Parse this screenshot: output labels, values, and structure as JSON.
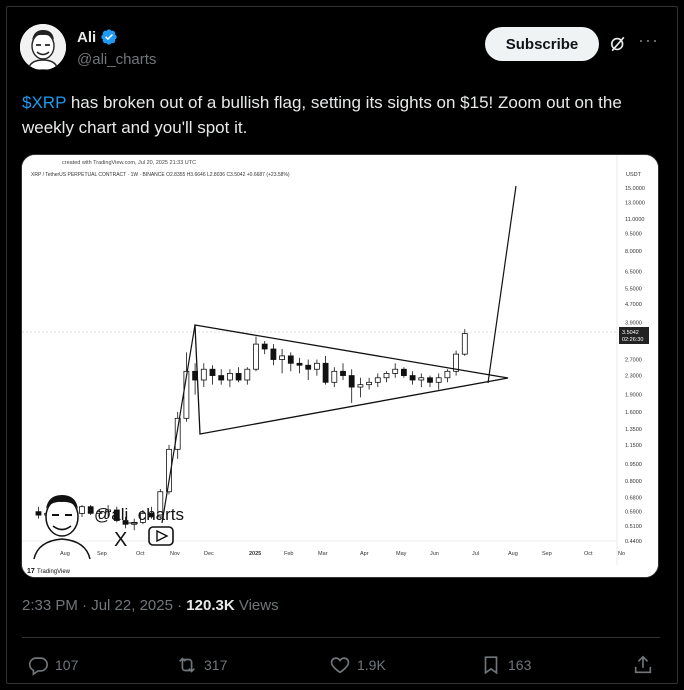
{
  "author": {
    "name": "Ali",
    "handle": "@ali_charts"
  },
  "header": {
    "subscribe_label": "Subscribe"
  },
  "tweet": {
    "cashtag": "$XRP",
    "text": " has broken out of a bullish flag, setting its sights on $15! Zoom out on the weekly chart and you'll spot it."
  },
  "chart": {
    "created": "created with TradingView.com, Jul 20, 2025 21:33 UTC",
    "symbol_line": "XRP / TetherUS PERPETUAL CONTRACT · 1W · BINANCE  O2.8355  H3.6646  L2.8036  C3.5042  +0.6687 (+23.58%)",
    "currency": "USDT",
    "watermark": "@ali_charts",
    "x_logo": "X",
    "brand": "TradingView",
    "price_tag": "3.5042",
    "price_time": "02:26:30",
    "chart_data": {
      "type": "candlestick",
      "title": "XRP / TetherUS PERPETUAL CONTRACT · 1W · BINANCE",
      "y_axis_scale": "log",
      "y_ticks": [
        "15.0000",
        "13.0000",
        "11.0000",
        "9.5000",
        "8.0000",
        "6.5000",
        "5.5000",
        "4.7000",
        "3.9000",
        "2.7000",
        "2.3000",
        "1.9000",
        "1.6000",
        "1.3500",
        "1.1500",
        "0.9500",
        "0.8000",
        "0.6800",
        "0.5900",
        "0.5100",
        "0.4400"
      ],
      "x_ticks": [
        "Aug",
        "Sep",
        "Oct",
        "Nov",
        "Dec",
        "2025",
        "Feb",
        "Mar",
        "Apr",
        "May",
        "Jun",
        "Jul",
        "Aug",
        "Sep",
        "Oct",
        "No"
      ],
      "last_price": 3.5042,
      "target": 15.0,
      "pattern": "bullish flag (triangle)"
    }
  },
  "timestamp": {
    "time": "2:33 PM",
    "date": "Jul 22, 2025",
    "views_count": "120.3K",
    "views_label": "Views"
  },
  "actions": {
    "replies": "107",
    "reposts": "317",
    "likes": "1.9K",
    "bookmarks": "163"
  },
  "colors": {
    "accent": "#1d9bf0",
    "background": "#000000",
    "muted": "#71767b"
  }
}
